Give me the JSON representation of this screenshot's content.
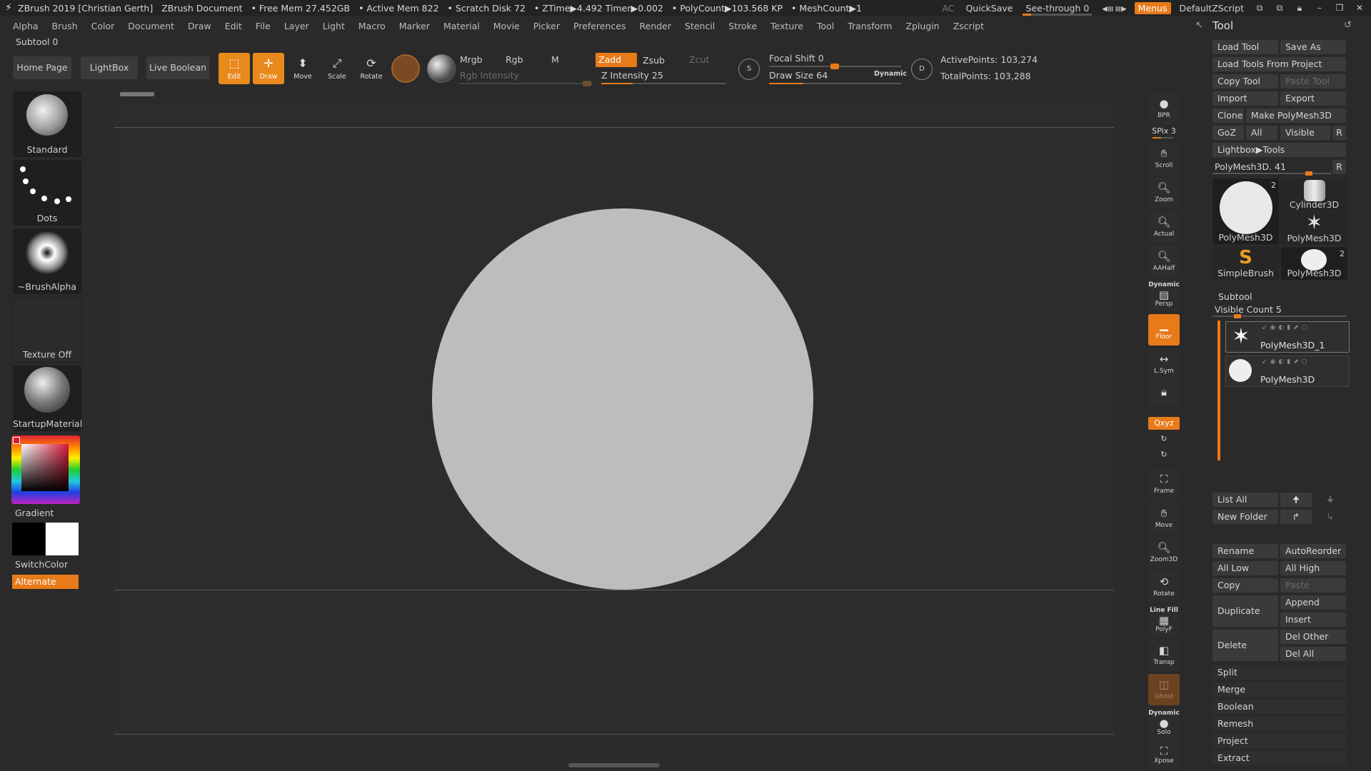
{
  "titlebar": {
    "app_title": "ZBrush 2019 [Christian Gerth]",
    "document": "ZBrush Document",
    "free_mem": "• Free Mem 27.452GB",
    "active_mem": "• Active Mem 822",
    "scratch_disk": "• Scratch Disk 72",
    "ztime": "• ZTime▶4.492 Timer▶0.002",
    "polycount": "• PolyCount▶103.568 KP",
    "meshcount": "• MeshCount▶1",
    "ac": "AC",
    "quicksave": "QuickSave",
    "see_through": "See-through  0",
    "see_through_value": 0,
    "menus": "Menus",
    "default_zscript": "DefaultZScript"
  },
  "menubar": [
    "Alpha",
    "Brush",
    "Color",
    "Document",
    "Draw",
    "Edit",
    "File",
    "Layer",
    "Light",
    "Macro",
    "Marker",
    "Material",
    "Movie",
    "Picker",
    "Preferences",
    "Render",
    "Stencil",
    "Stroke",
    "Texture",
    "Tool",
    "Transform",
    "Zplugin",
    "Zscript"
  ],
  "subtool_label": "Subtool 0",
  "toolbar": {
    "home_page": "Home Page",
    "lightbox": "LightBox",
    "live_boolean": "Live Boolean",
    "edit": "Edit",
    "draw": "Draw",
    "move": "Move",
    "scale": "Scale",
    "rotate": "Rotate",
    "mrgb": "Mrgb",
    "rgb": "Rgb",
    "m": "M",
    "zadd": "Zadd",
    "zsub": "Zsub",
    "zcut": "Zcut",
    "rgb_intensity": "Rgb Intensity",
    "z_intensity": "Z Intensity 25",
    "z_intensity_value": 25,
    "focal_shift": "Focal Shift 0",
    "focal_shift_value": 0,
    "draw_size": "Draw Size 64",
    "draw_size_value": 64,
    "dynamic": "Dynamic",
    "active_points": "ActivePoints: 103,274",
    "total_points": "TotalPoints: 103,288"
  },
  "left": {
    "brush": "Standard",
    "stroke": "Dots",
    "alpha": "~BrushAlpha",
    "texture": "Texture Off",
    "material": "StartupMaterial",
    "gradient": "Gradient",
    "switch_color": "SwitchColor",
    "alternate": "Alternate"
  },
  "shelf": {
    "bpr": "BPR",
    "spix": "SPix 3",
    "scroll": "Scroll",
    "zoom": "Zoom",
    "actual": "Actual",
    "aahalf": "AAHalf",
    "dynamic": "Dynamic",
    "persp": "Persp",
    "floor": "Floor",
    "lsym": "L.Sym",
    "xyz": "Qxyz",
    "frame": "Frame",
    "move": "Move",
    "zoom3d": "Zoom3D",
    "rotate": "Rotate",
    "line_fill": "Line Fill",
    "polyf": "PolyF",
    "transp": "Transp",
    "ghost": "Ghost",
    "dynamic_solo": "Dynamic",
    "solo": "Solo",
    "xpose": "Xpose"
  },
  "tool": {
    "title": "Tool",
    "load_tool": "Load Tool",
    "save_as": "Save As",
    "load_from_project": "Load Tools From Project",
    "copy_tool": "Copy Tool",
    "paste_tool": "Paste Tool",
    "import": "Import",
    "export": "Export",
    "clone": "Clone",
    "make_polymesh": "Make PolyMesh3D",
    "goz": "GoZ",
    "all": "All",
    "visible": "Visible",
    "r": "R",
    "lightbox_tools": "Lightbox▶Tools",
    "polymesh_slider": "PolyMesh3D. 41",
    "cards": [
      {
        "name": "PolyMesh3D",
        "count": "2"
      },
      {
        "name": "Cylinder3D",
        "count": ""
      },
      {
        "name": "PolyMesh3D",
        "count": ""
      },
      {
        "name": "SimpleBrush",
        "count": ""
      },
      {
        "name": "PolyMesh3D",
        "count": "2"
      }
    ],
    "subtool_title": "Subtool",
    "visible_count": "Visible Count 5",
    "subtools": [
      "PolyMesh3D_1",
      "PolyMesh3D"
    ],
    "list_all": "List All",
    "new_folder": "New Folder",
    "rename": "Rename",
    "auto_reorder": "AutoReorder",
    "all_low": "All Low",
    "all_high": "All High",
    "copy": "Copy",
    "paste": "Paste",
    "duplicate": "Duplicate",
    "append": "Append",
    "insert": "Insert",
    "delete": "Delete",
    "del_other": "Del Other",
    "del_all": "Del All",
    "split": "Split",
    "merge": "Merge",
    "boolean": "Boolean",
    "remesh": "Remesh",
    "project": "Project",
    "extract": "Extract"
  },
  "colors": {
    "accent": "#e87a1a",
    "background": "#2a2a2a",
    "mesh": "#bdbdbd"
  }
}
